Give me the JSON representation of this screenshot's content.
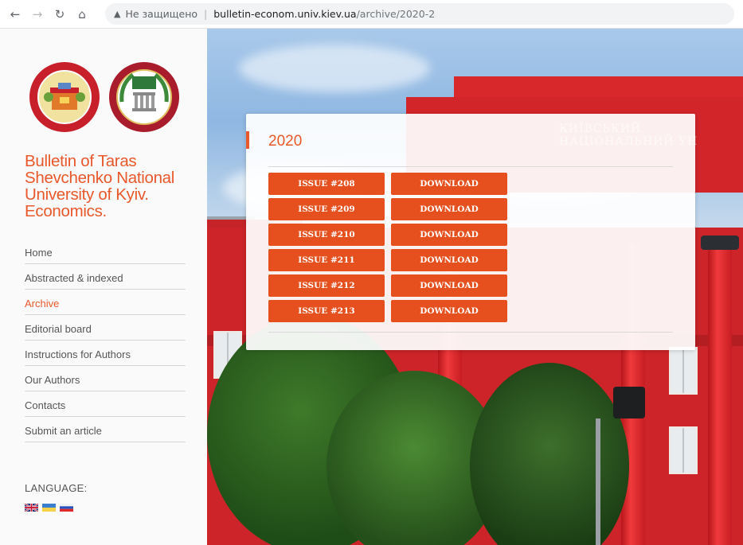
{
  "browser": {
    "icons": {
      "back": "arrow-left-icon",
      "forward": "arrow-right-icon",
      "reload": "reload-icon",
      "home": "home-icon",
      "security": "warning-triangle-icon"
    },
    "security_text": "Не защищено",
    "url_host": "bulletin-econom.univ.kiev.ua",
    "url_path": "/archive/2020-2"
  },
  "site": {
    "title": "Bulletin of Taras Shevchenko National University of Kyiv. Economics.",
    "accent_color": "#e9582b",
    "button_color": "#e6501e"
  },
  "menu": {
    "items": [
      {
        "label": "Home",
        "active": false
      },
      {
        "label": "Abstracted & indexed",
        "active": false
      },
      {
        "label": "Archive",
        "active": true
      },
      {
        "label": "Editorial board",
        "active": false
      },
      {
        "label": "Instructions for Authors",
        "active": false
      },
      {
        "label": "Our Authors",
        "active": false
      },
      {
        "label": "Contacts",
        "active": false
      },
      {
        "label": "Submit an article",
        "active": false
      }
    ]
  },
  "language": {
    "label": "LANGUAGE:",
    "flags": [
      "flag-uk-icon",
      "flag-ukraine-icon",
      "flag-russia-icon"
    ]
  },
  "hero": {
    "sign_text": "КИЇВСЬКИЙ НАЦІОНАЛЬНИЙ УН"
  },
  "archive": {
    "year": "2020",
    "issues": [
      {
        "label": "ISSUE #208",
        "download": "DOWNLOAD"
      },
      {
        "label": "ISSUE #209",
        "download": "DOWNLOAD"
      },
      {
        "label": "ISSUE #210",
        "download": "DOWNLOAD"
      },
      {
        "label": "ISSUE #211",
        "download": "DOWNLOAD"
      },
      {
        "label": "ISSUE #212",
        "download": "DOWNLOAD"
      },
      {
        "label": "ISSUE #213",
        "download": "DOWNLOAD"
      }
    ]
  }
}
